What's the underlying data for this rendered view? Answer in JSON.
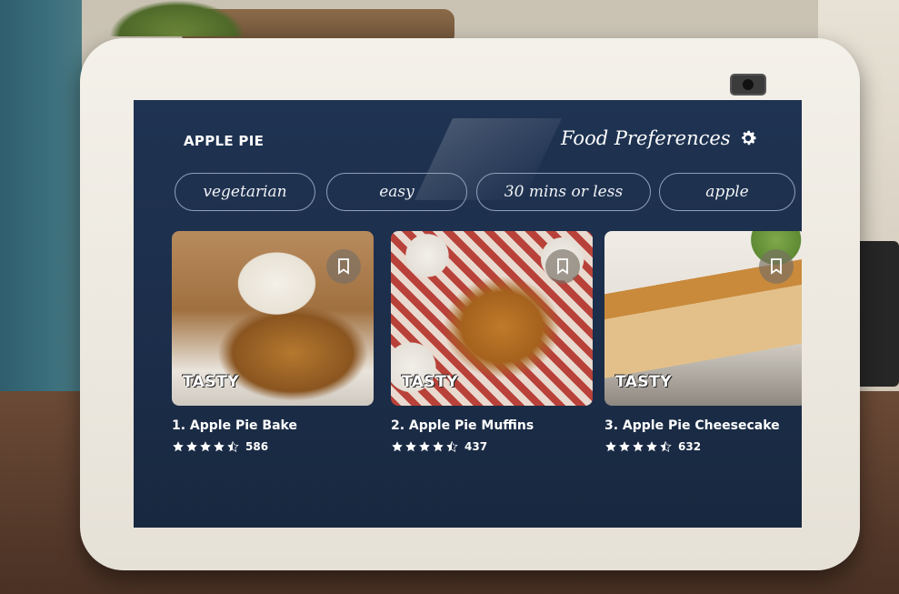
{
  "app": {
    "title": "APPLE PIE"
  },
  "header": {
    "preferences_label": "Food Preferences",
    "preferences_icon": "gear-icon"
  },
  "filters": [
    {
      "label": "vegetarian"
    },
    {
      "label": "easy"
    },
    {
      "label": "30 mins or less"
    },
    {
      "label": "apple"
    }
  ],
  "recipes": [
    {
      "name": "1. Apple Pie Bake",
      "rating": 4.5,
      "reviews": "586",
      "source": "TASTY",
      "bookmark_icon": "bookmark-icon"
    },
    {
      "name": "2. Apple Pie Muffins",
      "rating": 4.5,
      "reviews": "437",
      "source": "TASTY",
      "bookmark_icon": "bookmark-icon"
    },
    {
      "name": "3. Apple Pie Cheesecake",
      "rating": 4.5,
      "reviews": "632",
      "source": "TASTY",
      "bookmark_icon": "bookmark-icon"
    }
  ],
  "colors": {
    "screen_bg": "#1c2f4c",
    "chip_border": "#8fa0b8",
    "text": "#ffffff"
  }
}
